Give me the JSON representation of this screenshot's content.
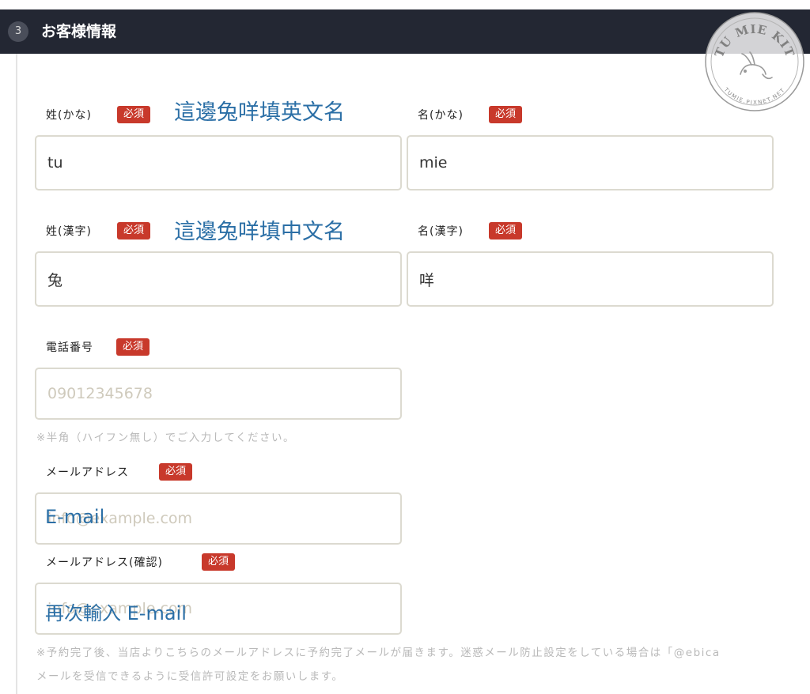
{
  "section": {
    "step_number": "3",
    "title": "お客様情報"
  },
  "required_badge": "必須",
  "fields": {
    "last_name_kana": {
      "label": "姓(かな)",
      "value": "tu"
    },
    "first_name_kana": {
      "label": "名(かな)",
      "value": "mie"
    },
    "last_name_kanji": {
      "label": "姓(漢字)",
      "value": "兔"
    },
    "first_name_kanji": {
      "label": "名(漢字)",
      "value": "咩"
    },
    "phone": {
      "label": "電話番号",
      "placeholder": "09012345678"
    },
    "email": {
      "label": "メールアドレス",
      "placeholder": "info@example.com"
    },
    "email_confirm": {
      "label": "メールアドレス(確認)",
      "placeholder": "info@example.com"
    }
  },
  "notes": {
    "phone": "※半角（ハイフン無し）でご入力してください。",
    "email_line1": "※予約完了後、当店よりこちらのメールアドレスに予約完了メールが届きます。迷惑メール防止設定をしている場合は「@ebica",
    "email_line2": "メールを受信できるように受信許可設定をお願いします。"
  },
  "annotations": {
    "kana": "這邊兔咩填英文名",
    "kanji": "這邊兔咩填中文名",
    "email": "E-mail",
    "email_confirm": "再次輸入 E-mail"
  },
  "watermark": {
    "top_text": "TU MIE KIT",
    "bottom_text": "TUMIE.PIXNET.NET"
  }
}
